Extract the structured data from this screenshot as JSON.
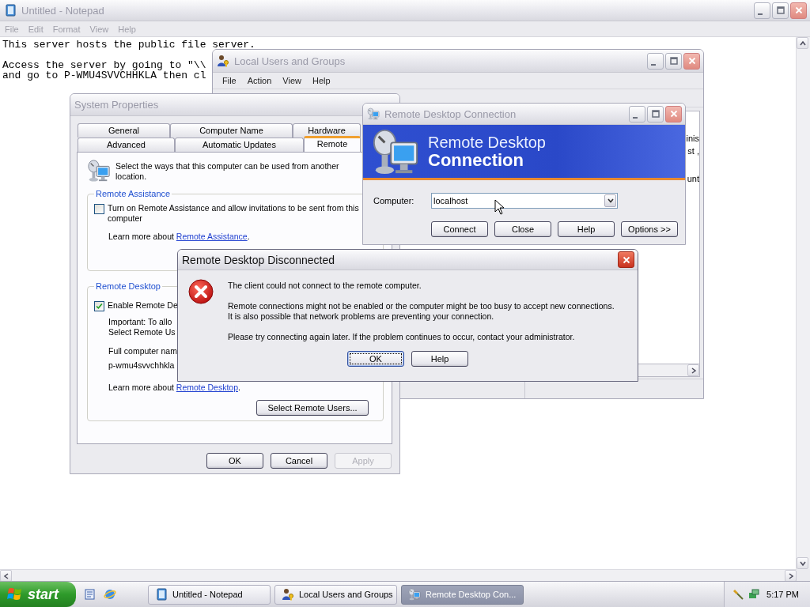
{
  "notepad": {
    "title": "Untitled - Notepad",
    "active": false,
    "menu": [
      "File",
      "Edit",
      "Format",
      "View",
      "Help"
    ],
    "paragraphs": [
      [
        "This server hosts the public file server."
      ],
      [
        "Access the server by going to \"\\\\",
        "and go to P-WMU4SVVCHHKLA then cl"
      ]
    ]
  },
  "local_users": {
    "title": "Local Users and Groups",
    "active": false,
    "menu": [
      "File",
      "Action",
      "View",
      "Help"
    ],
    "list_fragments": [
      "inis",
      "st ,",
      "unt"
    ]
  },
  "system_properties": {
    "title": "System Properties",
    "active": false,
    "tab_rows": [
      [
        {
          "label": "General",
          "selected": false
        },
        {
          "label": "Computer Name",
          "selected": false
        },
        {
          "label": "Hardware",
          "selected": false
        }
      ],
      [
        {
          "label": "Advanced",
          "selected": false
        },
        {
          "label": "Automatic Updates",
          "selected": false
        },
        {
          "label": "Remote",
          "selected": true
        }
      ]
    ],
    "intro": "Select the ways that this computer can be used from another location.",
    "remote_assistance": {
      "legend": "Remote Assistance",
      "checkbox": {
        "label": "Turn on Remote Assistance and allow invitations to be sent from this computer",
        "checked": false
      },
      "learn_more": {
        "text": "Learn more about",
        "link": "Remote Assistance",
        "suffix": "."
      }
    },
    "remote_desktop": {
      "legend": "Remote Desktop",
      "checkbox": {
        "label": "Enable Remote De",
        "checked": true
      },
      "important_lines": [
        "Important: To allo",
        "Select Remote Us"
      ],
      "full_name_label": "Full computer nam",
      "full_name": "p-wmu4svvchhkla",
      "learn_more": {
        "text": "Learn more about",
        "link": "Remote Desktop",
        "suffix": "."
      },
      "select_button": "Select Remote Users..."
    },
    "buttons": [
      {
        "label": "OK",
        "disabled": false
      },
      {
        "label": "Cancel",
        "disabled": false
      },
      {
        "label": "Apply",
        "disabled": true
      }
    ]
  },
  "remote_desktop": {
    "title": "Remote Desktop Connection",
    "active": false,
    "banner_line1": "Remote Desktop",
    "banner_line2": "Connection",
    "computer_label": "Computer:",
    "computer_value": "localhost",
    "buttons": [
      "Connect",
      "Close",
      "Help",
      "Options >>"
    ]
  },
  "disconnected_dialog": {
    "title": "Remote Desktop Disconnected",
    "active": true,
    "paragraphs": [
      [
        "The client could not connect to the remote computer."
      ],
      [
        "Remote connections might not be enabled or the computer might be too busy to accept new connections.",
        "It is also possible that network problems are preventing your connection."
      ],
      [
        "Please try connecting again later. If the problem continues to occur, contact your administrator."
      ]
    ],
    "buttons": [
      {
        "label": "OK",
        "default": true
      },
      {
        "label": "Help",
        "default": false
      }
    ]
  },
  "taskbar": {
    "start": "start",
    "tasks": [
      {
        "label": "Untitled - Notepad",
        "kind": "notepad",
        "selected": false
      },
      {
        "label": "Local Users and Groups",
        "kind": "users",
        "selected": false
      },
      {
        "label": "Remote Desktop Con...",
        "kind": "remote",
        "selected": true
      }
    ],
    "clock": "5:17 PM"
  }
}
